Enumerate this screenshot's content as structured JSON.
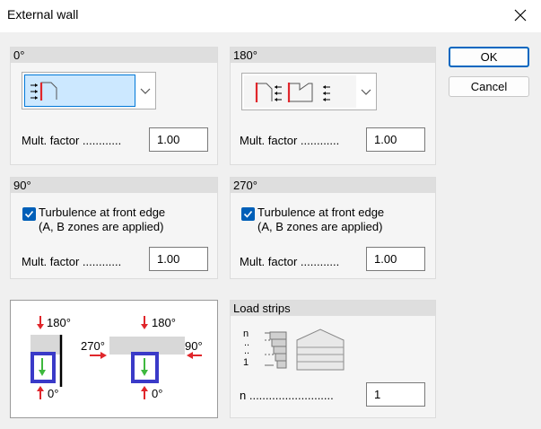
{
  "window": {
    "title": "External wall"
  },
  "buttons": {
    "ok": "OK",
    "cancel": "Cancel"
  },
  "groups": {
    "g0": {
      "title": "0°",
      "mult_label": "Mult. factor ............",
      "mult_value": "1.00"
    },
    "g180": {
      "title": "180°",
      "mult_label": "Mult. factor ............",
      "mult_value": "1.00"
    },
    "g90": {
      "title": "90°",
      "turb_line1": "Turbulence at front edge",
      "turb_line2": "(A, B zones are applied)",
      "turb_checked": true,
      "mult_label": "Mult. factor ............",
      "mult_value": "1.00"
    },
    "g270": {
      "title": "270°",
      "turb_line1": "Turbulence at front edge",
      "turb_line2": "(A, B zones are applied)",
      "turb_checked": true,
      "mult_label": "Mult. factor ............",
      "mult_value": "1.00"
    }
  },
  "diagram": {
    "top": "180°",
    "bottom": "0°",
    "left": "270°",
    "right": "90°"
  },
  "load_strips": {
    "title": "Load strips",
    "labels": [
      "n",
      "..",
      "..",
      "1"
    ],
    "n_label": "n ..........................",
    "n_value": "1"
  },
  "colors": {
    "accent": "#0067c0",
    "selection": "#cce8ff",
    "wall_red": "#e0262b",
    "arrow_green": "#3eb83e",
    "highlight_box": "#3a3ac8"
  }
}
